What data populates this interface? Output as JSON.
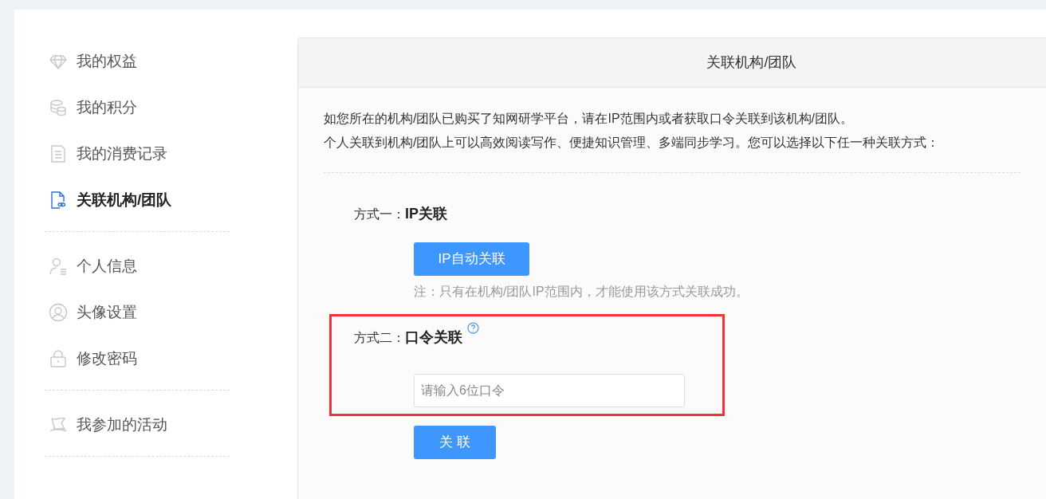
{
  "sidebar": {
    "groups": [
      {
        "items": [
          {
            "kind": "diamond",
            "label": "我的权益",
            "selected": false
          },
          {
            "kind": "coins",
            "label": "我的积分",
            "selected": false
          },
          {
            "kind": "document",
            "label": "我的消费记录",
            "selected": false
          },
          {
            "kind": "link-doc",
            "label": "关联机构/团队",
            "selected": true
          }
        ]
      },
      {
        "items": [
          {
            "kind": "user",
            "label": "个人信息",
            "selected": false
          },
          {
            "kind": "avatar",
            "label": "头像设置",
            "selected": false
          },
          {
            "kind": "lock",
            "label": "修改密码",
            "selected": false
          }
        ]
      },
      {
        "items": [
          {
            "kind": "flag",
            "label": "我参加的活动",
            "selected": false
          }
        ]
      }
    ]
  },
  "panel": {
    "title": "关联机构/团队",
    "intro": [
      "如您所在的机构/团队已购买了知网研学平台，请在IP范围内或者获取口令关联到该机构/团队。",
      "个人关联到机构/团队上可以高效阅读写作、便捷知识管理、多端同步学习。您可以选择以下任一种关联方式："
    ],
    "methods": [
      {
        "kind": "ip",
        "label": "方式一：",
        "title": "IP关联",
        "button": "IP自动关联",
        "note": "注：只有在机构/团队IP范围内，才能使用该方式关联成功。"
      },
      {
        "kind": "code",
        "label": "方式二：",
        "title": "口令关联",
        "help": true,
        "placeholder": "请输入6位口令",
        "button": "关 联",
        "highlighted": true
      }
    ]
  }
}
